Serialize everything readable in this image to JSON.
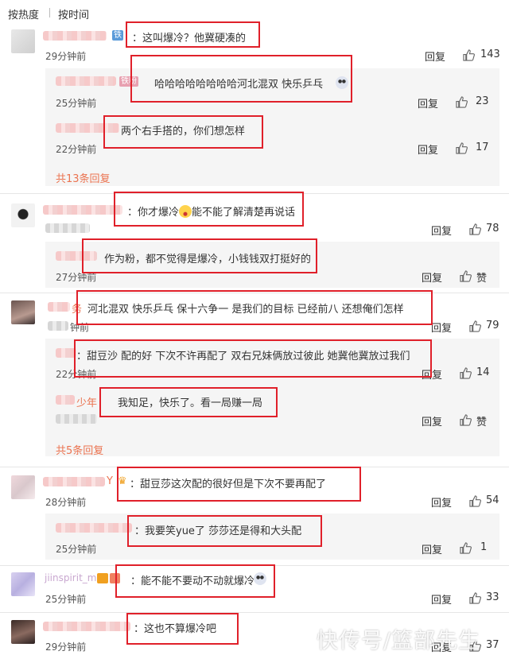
{
  "sort": {
    "hot": "按热度",
    "time": "按时间"
  },
  "reply_label": "回复",
  "like_label": "赞",
  "comments": {
    "c1": {
      "badge": "铁",
      "text": "：这叫爆冷？他冀硬凑的",
      "time": "29分钟前",
      "likes": "143"
    },
    "r1a": {
      "badge": "铁粉",
      "text": "哈哈哈哈哈哈哈哈河北混双 快乐乒乓",
      "time": "25分钟前",
      "likes": "23"
    },
    "r1b": {
      "text": "两个右手搭的，你们想怎样",
      "time": "22分钟前",
      "likes": "17"
    },
    "more1": "共13条回复",
    "c2": {
      "text_pre": "：你才爆冷",
      "text_post": "能不能了解清楚再说话",
      "likes": "78"
    },
    "r2a": {
      "text": "作为粉，都不觉得是爆冷，小钱钱双打挺好的",
      "time": "27分钟前",
      "likes": "赞"
    },
    "c3": {
      "name_suffix": "务",
      "text": "河北混双 快乐乒乓  保十六争一 是我们的目标 已经前八 还想俺们怎样",
      "time": "钟前",
      "likes": "79"
    },
    "r3a": {
      "text": "：甜豆沙 配的好 下次不许再配了 双右兄妹俩放过彼此 她冀他冀放过我们",
      "time": "22分钟前",
      "likes": "14"
    },
    "r3b": {
      "name": "少年",
      "text": "我知足，快乐了。看一局赚一局",
      "likes": "赞"
    },
    "more3": "共5条回复",
    "c4": {
      "name_suffix": "Y",
      "text": "：甜豆莎这次配的很好但是下次不要再配了",
      "time": "28分钟前",
      "likes": "54"
    },
    "r4a": {
      "text": "：我要笑yue了 莎莎还是得和大头配",
      "time": "25分钟前",
      "likes": "1"
    },
    "c5": {
      "name": "jiinspirit_m",
      "text": "：能不能不要动不动就爆冷",
      "time": "25分钟前",
      "likes": "33"
    },
    "c6": {
      "text": "：这也不算爆冷吧",
      "time": "29分钟前",
      "likes": "37"
    }
  },
  "watermark": "快传号/篮部先生",
  "colors": {
    "highlight_box": "#e0202a",
    "more_link": "#eb7350",
    "reply_bg": "#f5f5f5"
  }
}
